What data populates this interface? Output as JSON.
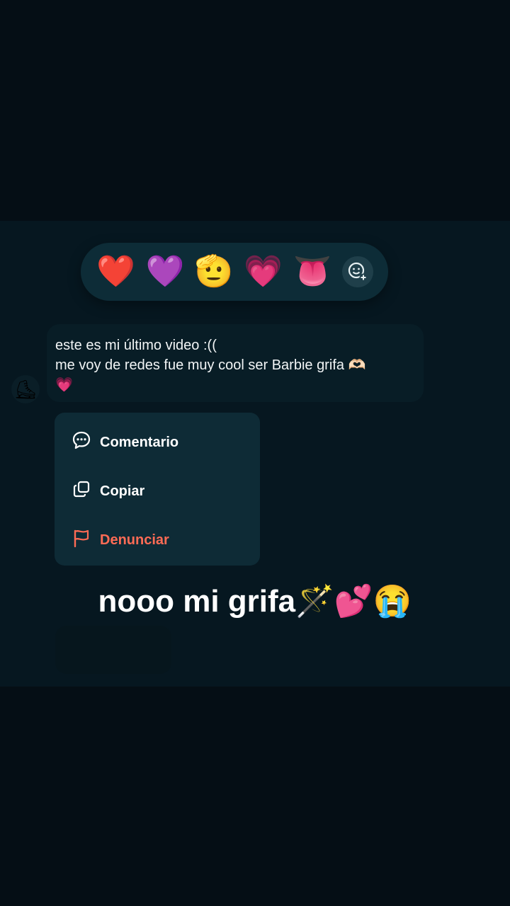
{
  "reactions": [
    {
      "emoji": "❤️",
      "icon": "red-heart-icon"
    },
    {
      "emoji": "💜",
      "icon": "purple-heart-icon"
    },
    {
      "emoji": "🫡",
      "icon": "face-icon"
    },
    {
      "emoji": "💗",
      "icon": "pink-heart-icon"
    },
    {
      "emoji": "👅",
      "icon": "tongue-icon"
    },
    {
      "emoji": "☺",
      "icon": "add-reaction-icon"
    }
  ],
  "message": {
    "line1": "este es mi último video :((",
    "line2": "me voy de redes fue muy cool ser Barbie grifa 🫶🏻",
    "line3": "💗"
  },
  "menu": {
    "comment_label": "Comentario",
    "copy_label": "Copiar",
    "report_label": "Denunciar"
  },
  "caption": "nooo mi grifa🪄💕😭",
  "colors": {
    "background": "#050e15",
    "overlay": "#061720",
    "pill": "#0d2c37",
    "menu": "#0e2b36",
    "danger": "#ff6b55",
    "text": "#f2f5f6"
  }
}
